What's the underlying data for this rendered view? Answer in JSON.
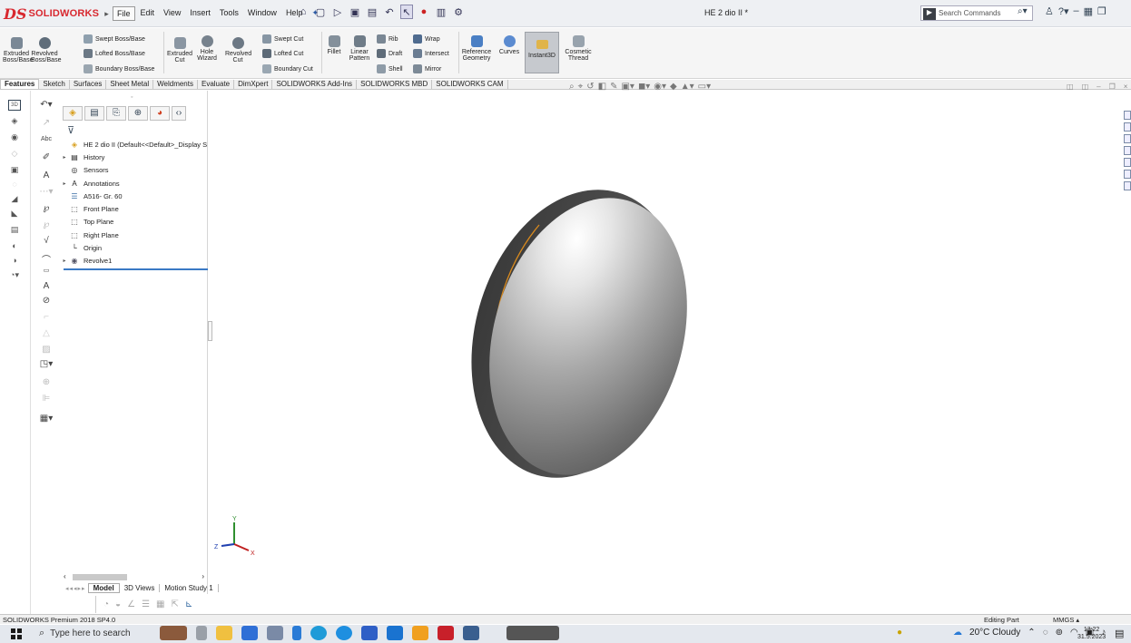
{
  "app": {
    "logo_text": "SOLIDWORKS",
    "doc_title": "HE 2 dio II *",
    "search_placeholder": "Search Commands"
  },
  "menus": [
    "File",
    "Edit",
    "View",
    "Insert",
    "Tools",
    "Window",
    "Help"
  ],
  "ribbon": {
    "extruded_boss": "Extruded Boss/Base",
    "revolved_boss": "Revolved Boss/Base",
    "swept_boss": "Swept Boss/Base",
    "lofted_boss": "Lofted Boss/Base",
    "boundary_boss": "Boundary Boss/Base",
    "extruded_cut": "Extruded Cut",
    "hole_wizard": "Hole Wizard",
    "revolved_cut": "Revolved Cut",
    "swept_cut": "Swept Cut",
    "lofted_cut": "Lofted Cut",
    "boundary_cut": "Boundary Cut",
    "fillet": "Fillet",
    "linear_pattern": "Linear Pattern",
    "rib": "Rib",
    "draft": "Draft",
    "shell": "Shell",
    "wrap": "Wrap",
    "intersect": "Intersect",
    "mirror": "Mirror",
    "reference_geometry": "Reference Geometry",
    "curves": "Curves",
    "instant3d": "Instant3D",
    "cosmetic_thread": "Cosmetic Thread"
  },
  "tabs": [
    "Features",
    "Sketch",
    "Surfaces",
    "Sheet Metal",
    "Weldments",
    "Evaluate",
    "DimXpert",
    "SOLIDWORKS Add-Ins",
    "SOLIDWORKS MBD",
    "SOLIDWORKS CAM"
  ],
  "active_tab": "Features",
  "tree": {
    "root": "HE 2 dio II  (Default<<Default>_Display S",
    "items": [
      {
        "label": "History",
        "caret": true
      },
      {
        "label": "Sensors",
        "caret": false
      },
      {
        "label": "Annotations",
        "caret": true
      },
      {
        "label": "A516- Gr. 60",
        "caret": false
      },
      {
        "label": "Front Plane",
        "caret": false
      },
      {
        "label": "Top Plane",
        "caret": false
      },
      {
        "label": "Right Plane",
        "caret": false
      },
      {
        "label": "Origin",
        "caret": false
      },
      {
        "label": "Revolve1",
        "caret": true
      }
    ]
  },
  "model_tabs": [
    "Model",
    "3D Views",
    "Motion Study 1"
  ],
  "active_model_tab": "Model",
  "triad": {
    "x": "X",
    "y": "Y",
    "z": "Z"
  },
  "status": {
    "version": "SOLIDWORKS Premium 2018 SP4.0",
    "mode": "Editing Part",
    "units": "MMGS"
  },
  "taskbar": {
    "search_text": "Type here to search",
    "weather": "20°C  Cloudy",
    "time": "13:22",
    "date": "31.5.2023"
  },
  "colors": {
    "brand_red": "#d8282f",
    "accent_blue": "#3a79c5",
    "edge_orange": "#d98a1e"
  }
}
